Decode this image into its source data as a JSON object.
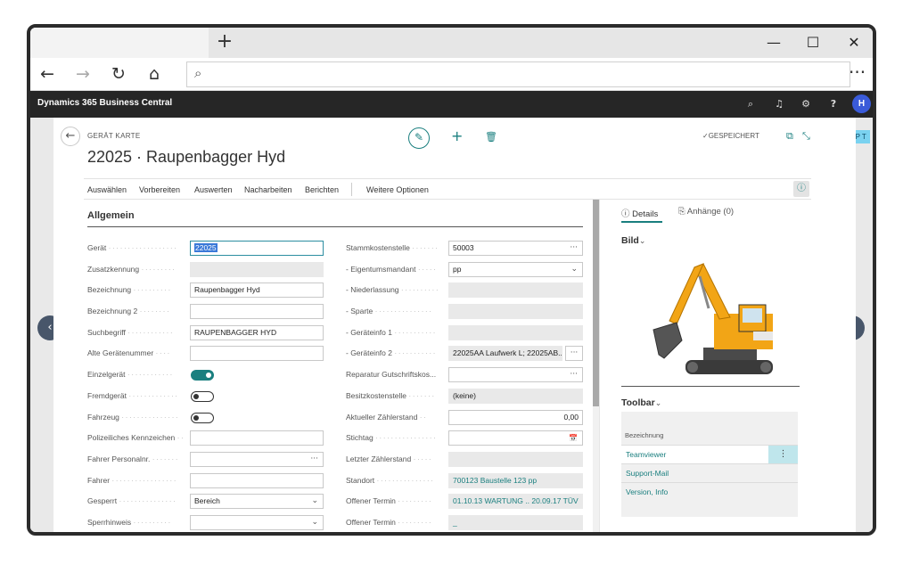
{
  "browser": {
    "new_tab_glyph": "+",
    "minimize_glyph": "—",
    "maximize_glyph": "☐",
    "close_glyph": "✕",
    "back_glyph": "←",
    "forward_glyph": "→",
    "refresh_glyph": "↻",
    "home_glyph": "⌂",
    "address_icon": "⌕",
    "more_glyph": "···"
  },
  "app": {
    "title": "Dynamics 365 Business Central",
    "icons": [
      "search-icon",
      "bell-icon",
      "gear-icon",
      "help-icon"
    ],
    "search_glyph": "⌕",
    "bell_glyph": "♫",
    "gear_glyph": "⚙",
    "help_glyph": "?",
    "avatar_initial": "H",
    "tag": "PP T"
  },
  "page": {
    "breadcrumb": "GERÄT KARTE",
    "title": "22025 · Raupenbagger Hyd",
    "edit_glyph": "✎",
    "add_glyph": "+",
    "delete_glyph": "🗑",
    "saved_label": "✓GESPEICHERT",
    "popout_glyph": "⧉",
    "collapse_glyph": "⤡",
    "prev_glyph": "‹",
    "next_glyph": "›",
    "back_glyph": "←"
  },
  "actions": {
    "items": [
      "Auswählen",
      "Vorbereiten",
      "Auswerten",
      "Nacharbeiten",
      "Berichten"
    ],
    "more": "Weitere Optionen",
    "info_glyph": "ⓘ"
  },
  "section": {
    "title": "Allgemein"
  },
  "left_fields": [
    {
      "label": "Gerät",
      "value": "22025"
    },
    {
      "label": "Zusatzkennung",
      "value": ""
    },
    {
      "label": "Bezeichnung",
      "value": "Raupenbagger Hyd"
    },
    {
      "label": "Bezeichnung 2",
      "value": ""
    },
    {
      "label": "Suchbegriff",
      "value": "RAUPENBAGGER HYD"
    },
    {
      "label": "Alte Gerätenummer",
      "value": ""
    },
    {
      "label": "Einzelgerät",
      "value": ""
    },
    {
      "label": "Fremdgerät",
      "value": ""
    },
    {
      "label": "Fahrzeug",
      "value": ""
    },
    {
      "label": "Polizeiliches Kennzeichen",
      "value": ""
    },
    {
      "label": "Fahrer Personalnr.",
      "value": "",
      "tail": "···"
    },
    {
      "label": "Fahrer",
      "value": ""
    },
    {
      "label": "Gesperrt",
      "value": "Bereich",
      "tail": "⌄"
    },
    {
      "label": "Sperrhinweis",
      "value": "",
      "tail": "⌄"
    }
  ],
  "right_fields": [
    {
      "label": "Stammkostenstelle",
      "value": "50003",
      "tail": "···"
    },
    {
      "label": "- Eigentumsmandant",
      "value": "pp",
      "tail": "⌄"
    },
    {
      "label": "- Niederlassung",
      "value": ""
    },
    {
      "label": "- Sparte",
      "value": ""
    },
    {
      "label": "- Geräteinfo 1",
      "value": ""
    },
    {
      "label": "- Geräteinfo 2",
      "value": "22025AA Laufwerk L; 22025AB...",
      "tail": "···"
    },
    {
      "label": "Reparatur Gutschriftskos...",
      "value": "",
      "tail": "···"
    },
    {
      "label": "Besitzkostenstelle",
      "value": "(keine)"
    },
    {
      "label": "Aktueller Zählerstand",
      "value": "0,00"
    },
    {
      "label": "Stichtag",
      "value": "",
      "tail": "📅"
    },
    {
      "label": "Letzter Zählerstand",
      "value": ""
    },
    {
      "label": "Standort",
      "value": "700123 Baustelle 123 pp"
    },
    {
      "label": "Offener Termin",
      "value": "01.10.13 WARTUNG .. 20.09.17 TÜV"
    },
    {
      "label": "Offener Termin",
      "value": "_"
    }
  ],
  "factbox": {
    "tab_details": "Details",
    "tab_details_glyph": "ⓘ",
    "tab_attachments": "Anhänge (0)",
    "tab_attachments_glyph": "⎘",
    "picture_title": "Bild",
    "chevron_glyph": "⌄",
    "toolbar_title": "Toolbar",
    "column_header": "Bezeichnung",
    "rows": [
      "Teamviewer",
      "Support-Mail",
      "Version, Info"
    ],
    "row_more_glyph": "⋮"
  },
  "colors": {
    "accent": "#1a7f7f",
    "appbar": "#262626",
    "avatar": "#3a5bd9",
    "excavator_yellow": "#f2a516"
  }
}
